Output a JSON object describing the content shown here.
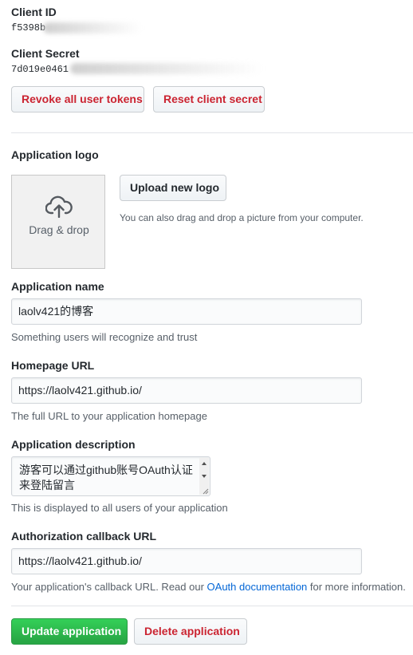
{
  "client_id": {
    "label": "Client ID",
    "value": "f5398b"
  },
  "client_secret": {
    "label": "Client Secret",
    "value": "7d019e0461"
  },
  "actions_top": {
    "revoke_label": "Revoke all user tokens",
    "reset_label": "Reset client secret"
  },
  "logo": {
    "label": "Application logo",
    "dropzone_text": "Drag & drop",
    "dropzone_icon": "cloud-upload-icon",
    "upload_label": "Upload new logo",
    "upload_note": "You can also drag and drop a picture from your computer."
  },
  "app_name": {
    "label": "Application name",
    "value": "laolv421的博客",
    "hint": "Something users will recognize and trust"
  },
  "homepage": {
    "label": "Homepage URL",
    "value": "https://laolv421.github.io/",
    "hint": "The full URL to your application homepage"
  },
  "description": {
    "label": "Application description",
    "value": "游客可以通过github账号OAuth认证来登陆留言",
    "hint": "This is displayed to all users of your application"
  },
  "callback": {
    "label": "Authorization callback URL",
    "value": "https://laolv421.github.io/",
    "hint_before": "Your application's callback URL. Read our ",
    "hint_link": "OAuth documentation",
    "hint_after": " for more information."
  },
  "actions_bottom": {
    "update_label": "Update application",
    "delete_label": "Delete application"
  },
  "colors": {
    "danger": "#cb2431",
    "primary": "#28a745",
    "link": "#0366d6",
    "muted": "#586069"
  }
}
